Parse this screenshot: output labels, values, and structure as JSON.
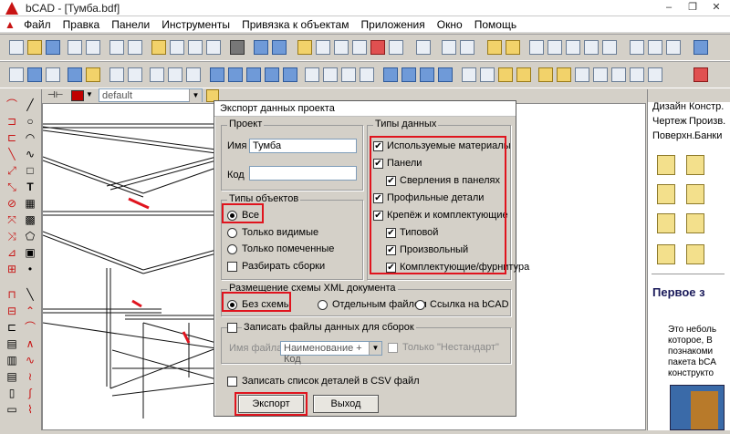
{
  "window": {
    "title": "bCAD - [Тумба.bdf]",
    "min": "–",
    "restore": "❐",
    "close": "✕"
  },
  "menu": [
    "Файл",
    "Правка",
    "Панели",
    "Инструменты",
    "Привязка к объектам",
    "Приложения",
    "Окно",
    "Помощь"
  ],
  "props": {
    "layer": "default"
  },
  "right_panel": {
    "tabs": [
      "Дизайн",
      "Констр.",
      "Чертеж",
      "Произв.",
      "Поверхн.",
      "Банки"
    ],
    "heading": "Первое з",
    "text": [
      "Это неболь",
      "которое, В",
      "познакоми",
      "пакета bCA",
      "конструкто"
    ]
  },
  "dialog": {
    "title": "Экспорт данных проекта",
    "project": {
      "legend": "Проект",
      "name_label": "Имя",
      "name_value": "Тумба",
      "code_label": "Код",
      "code_value": ""
    },
    "object_types": {
      "legend": "Типы объектов",
      "options": [
        "Все",
        "Только видимые",
        "Только помеченные"
      ],
      "selected": "Все",
      "split_assemblies": "Разбирать сборки"
    },
    "data_types": {
      "legend": "Типы данных",
      "items": [
        {
          "label": "Используемые материалы",
          "checked": true
        },
        {
          "label": "Панели",
          "checked": true
        },
        {
          "label": "Сверления в панелях",
          "checked": true
        },
        {
          "label": "Профильные детали",
          "checked": true
        },
        {
          "label": "Крепёж и комплектующие",
          "checked": true
        },
        {
          "label": "Типовой",
          "checked": true
        },
        {
          "label": "Произвольный",
          "checked": true
        },
        {
          "label": "Комплектующие/фурнитура",
          "checked": true
        }
      ]
    },
    "xml_schema": {
      "legend": "Размещение схемы XML документа",
      "options": [
        "Без схемы",
        "Отдельным файлом",
        "Ссылка на bCAD"
      ],
      "selected": "Без схемы"
    },
    "write_assembly_files": "Записать файлы данных для сборок",
    "file_name_label": "Имя файла",
    "file_name_value": "Наименование + Код",
    "nonstandard": "Только \"Нестандарт\"",
    "write_csv": "Записать список деталей в CSV файл",
    "export_button": "Экспорт",
    "exit_button": "Выход"
  }
}
